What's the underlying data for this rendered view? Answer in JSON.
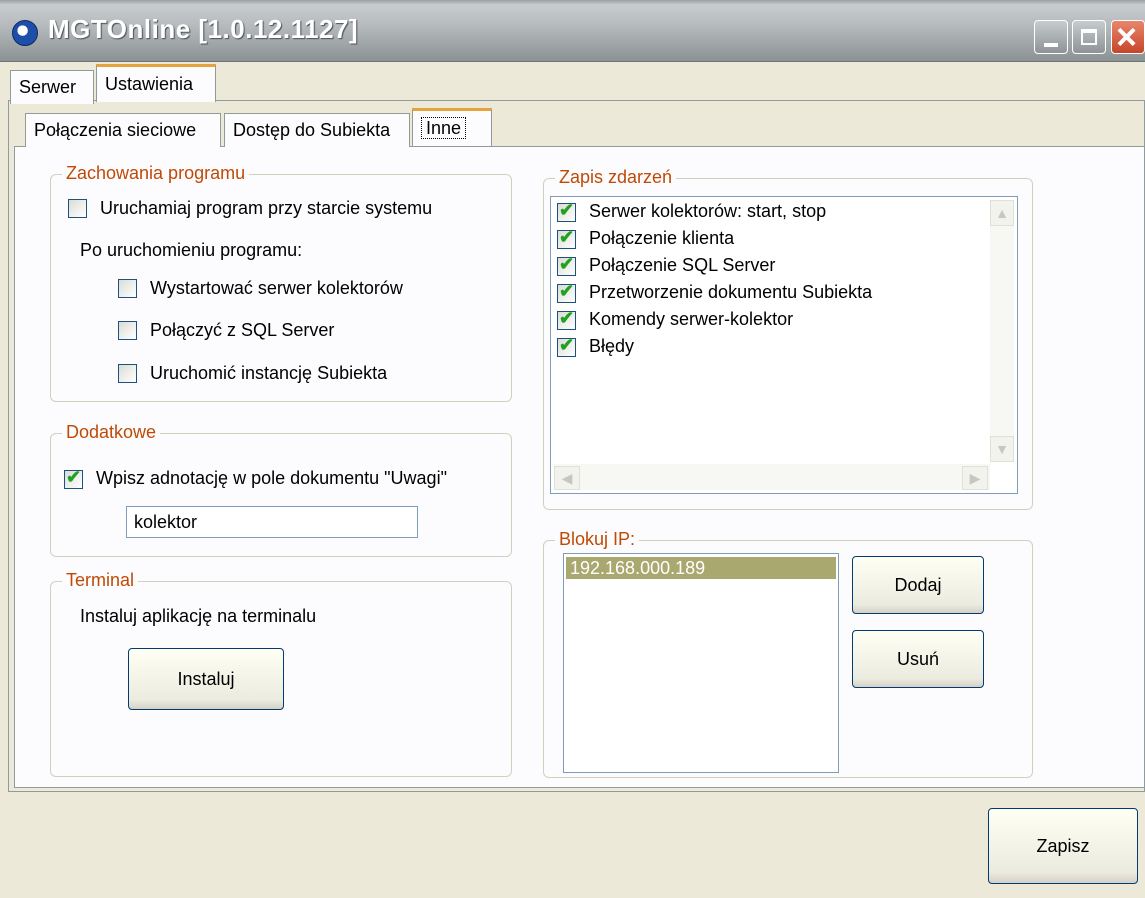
{
  "window": {
    "title": "MGTOnline [1.0.12.1127]"
  },
  "main_tabs": [
    {
      "label": "Serwer"
    },
    {
      "label": "Ustawienia"
    }
  ],
  "sub_tabs": [
    {
      "label": "Połączenia sieciowe"
    },
    {
      "label": "Dostęp do Subiekta"
    },
    {
      "label": "Inne"
    }
  ],
  "zachowania": {
    "legend": "Zachowania programu",
    "autostart_label": "Uruchamiaj program przy starcie systemu",
    "after_start_label": "Po uruchomieniu programu:",
    "options": [
      {
        "label": "Wystartować serwer kolektorów"
      },
      {
        "label": "Połączyć z SQL Server"
      },
      {
        "label": "Uruchomić instancję Subiekta"
      }
    ]
  },
  "dodatkowe": {
    "legend": "Dodatkowe",
    "annotate_label": "Wpisz adnotację w pole dokumentu \"Uwagi\"",
    "annotate_value": "kolektor"
  },
  "terminal": {
    "legend": "Terminal",
    "install_text": "Instaluj aplikację na terminalu",
    "install_button": "Instaluj"
  },
  "zapis": {
    "legend": "Zapis zdarzeń",
    "items": [
      {
        "label": "Serwer kolektorów: start, stop"
      },
      {
        "label": "Połączenie klienta"
      },
      {
        "label": "Połączenie SQL Server"
      },
      {
        "label": "Przetworzenie dokumentu Subiekta"
      },
      {
        "label": "Komendy serwer-kolektor"
      },
      {
        "label": "Błędy"
      }
    ]
  },
  "blokuj": {
    "legend": "Blokuj IP:",
    "ips": [
      "192.168.000.189"
    ],
    "add_button": "Dodaj",
    "remove_button": "Usuń"
  },
  "save_button": "Zapisz"
}
